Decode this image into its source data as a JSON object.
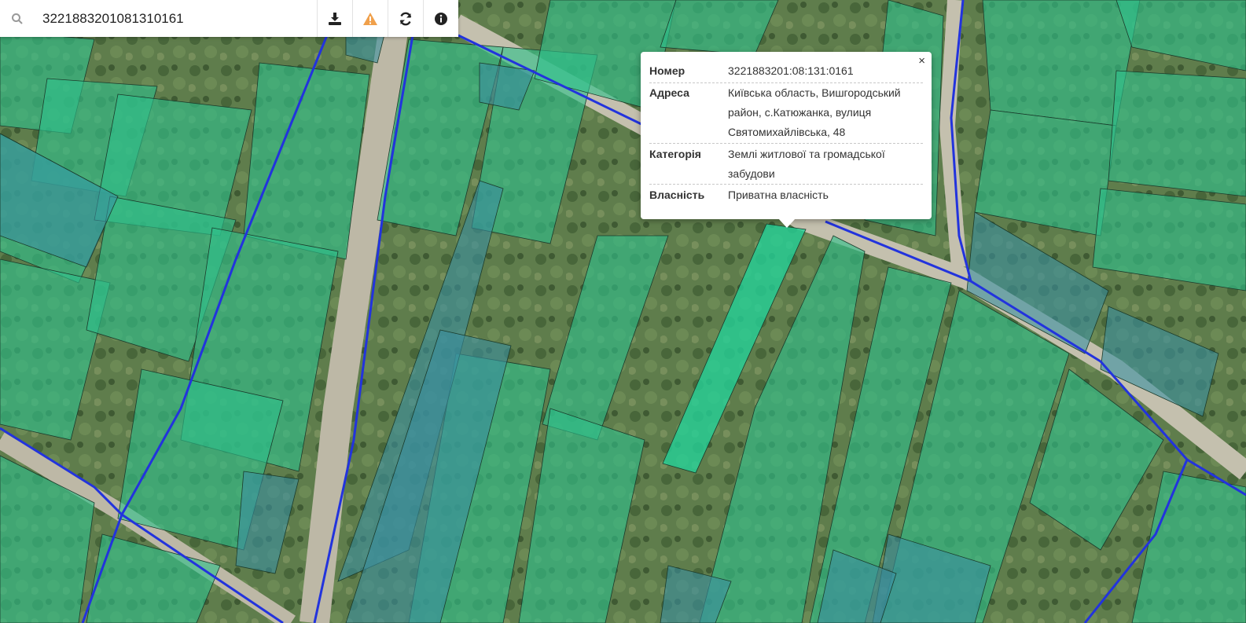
{
  "search": {
    "value": "3221883201081310161",
    "placeholder": ""
  },
  "toolbar": [
    {
      "name": "download-icon",
      "color": "#222222"
    },
    {
      "name": "warning-icon",
      "color": "#f0a04b"
    },
    {
      "name": "refresh-icon",
      "color": "#222222"
    },
    {
      "name": "info-icon",
      "color": "#222222"
    }
  ],
  "popup": {
    "close_label": "×",
    "rows": [
      {
        "label": "Номер",
        "value": "3221883201:08:131:0161"
      },
      {
        "label": "Адреса",
        "value_lines": [
          "Київська область, Вишгородський",
          "район, с.Катюжанка, вулиця",
          "Святомихайлівська, 48"
        ]
      },
      {
        "label": "Категорія",
        "value_lines": [
          "Землі житлової та громадської",
          "забудови"
        ]
      },
      {
        "label": "Власність",
        "value": "Приватна власність"
      }
    ]
  },
  "map": {
    "parcel_fill": "#2fc08a",
    "selected_parcel_fill": "#22d39a",
    "shaded_parcel_fill": "#3a8fa0",
    "boundary_color": "#2233dd"
  }
}
